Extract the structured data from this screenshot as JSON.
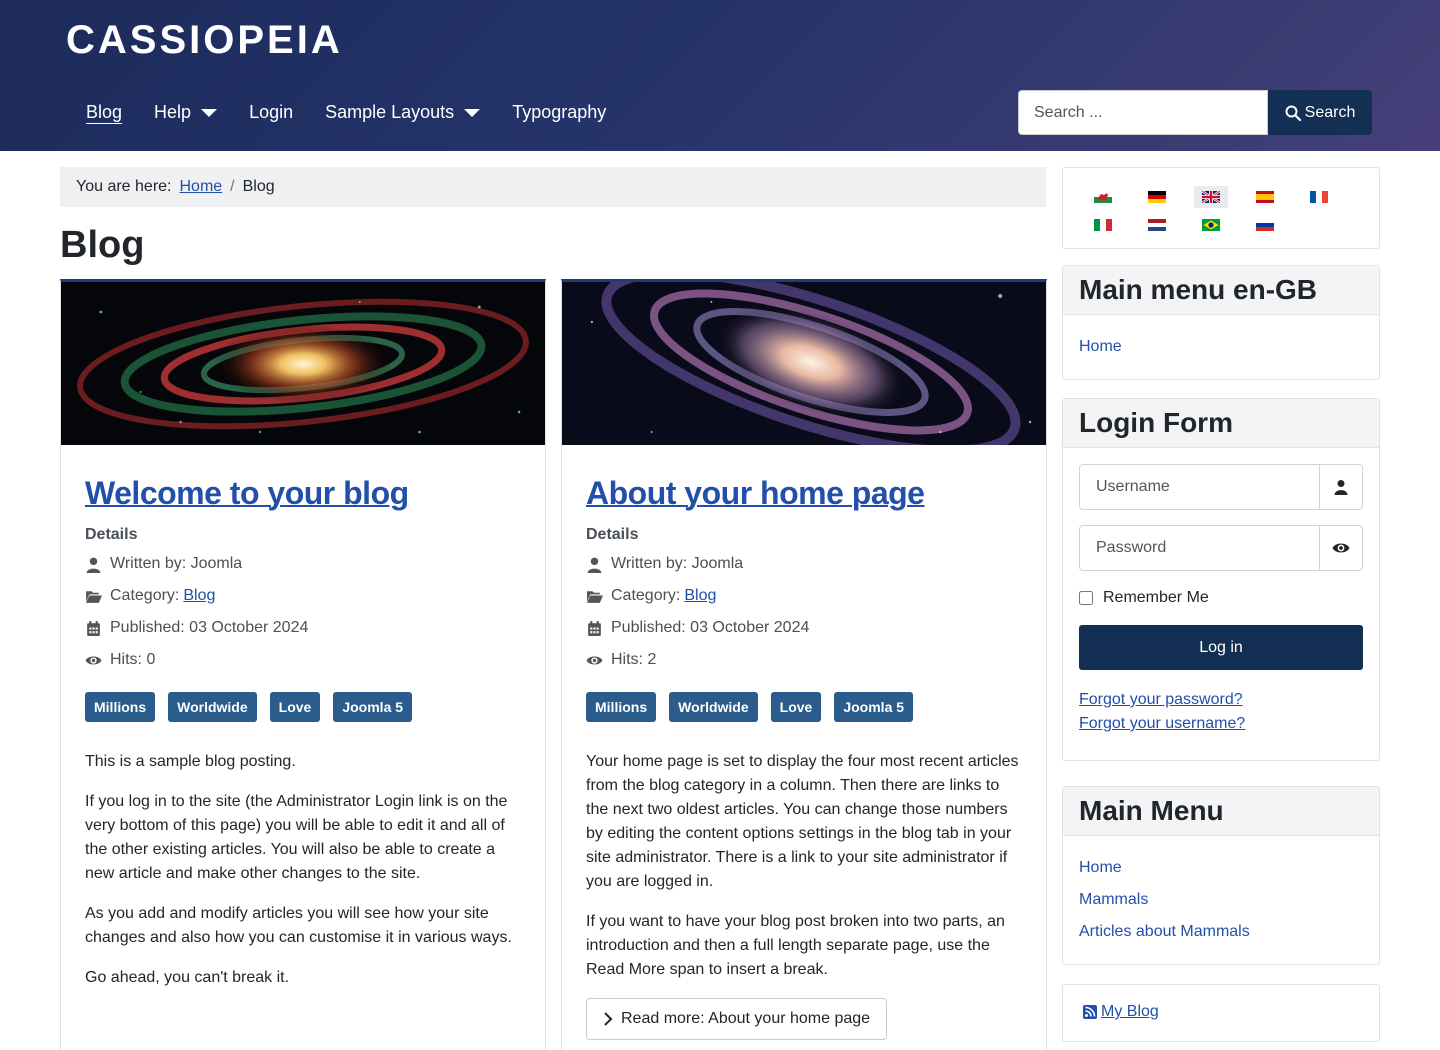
{
  "header": {
    "brand": "CASSIOPEIA",
    "nav": [
      {
        "label": "Blog"
      },
      {
        "label": "Help"
      },
      {
        "label": "Login"
      },
      {
        "label": "Sample Layouts"
      },
      {
        "label": "Typography"
      }
    ],
    "search_placeholder": "Search ...",
    "search_button": "Search"
  },
  "breadcrumb": {
    "prefix": "You are here:",
    "home": "Home",
    "separator": "/",
    "current": "Blog"
  },
  "page_title": "Blog",
  "articles": [
    {
      "title": "Welcome to your blog",
      "details_label": "Details",
      "author": "Written by: Joomla",
      "category_prefix": "Category:",
      "category": "Blog",
      "published": "Published: 03 October 2024",
      "hits": "Hits: 0",
      "tags": [
        "Millions",
        "Worldwide",
        "Love",
        "Joomla 5"
      ],
      "paragraphs": [
        "This is a sample blog posting.",
        "If you log in to the site (the Administrator Login link is on the very bottom of this page) you will be able to edit it and all of the other existing articles. You will also be able to create a new article and make other changes to the site.",
        "As you add and modify articles you will see how your site changes and also how you can customise it in various ways.",
        "Go ahead, you can't break it."
      ]
    },
    {
      "title": "About your home page",
      "details_label": "Details",
      "author": "Written by: Joomla",
      "category_prefix": "Category:",
      "category": "Blog",
      "published": "Published: 03 October 2024",
      "hits": "Hits: 2",
      "tags": [
        "Millions",
        "Worldwide",
        "Love",
        "Joomla 5"
      ],
      "paragraphs": [
        "Your home page is set to display the four most recent articles from the blog category in a column. Then there are links to the next two oldest articles. You can change those numbers by editing the content options settings in the blog tab in your site administrator. There is a link to your site administrator if you are logged in.",
        "If you want to have your blog post broken into two parts, an introduction and then a full length separate page, use the Read More span to insert a break."
      ],
      "read_more": "Read more: About your home page"
    }
  ],
  "sidebar": {
    "main_menu_engb": {
      "title": "Main menu en-GB",
      "items": [
        "Home"
      ]
    },
    "login": {
      "title": "Login Form",
      "username_placeholder": "Username",
      "password_placeholder": "Password",
      "remember": "Remember Me",
      "button": "Log in",
      "forgot_password": "Forgot your password?",
      "forgot_username": "Forgot your username?"
    },
    "main_menu": {
      "title": "Main Menu",
      "items": [
        "Home",
        "Mammals",
        "Articles about Mammals"
      ]
    },
    "feed": {
      "label": "My Blog"
    }
  },
  "colors": {
    "accent": "#224faa",
    "header_dark": "#1c2b5a",
    "button": "#132f53",
    "tag": "#2a5d8b"
  }
}
